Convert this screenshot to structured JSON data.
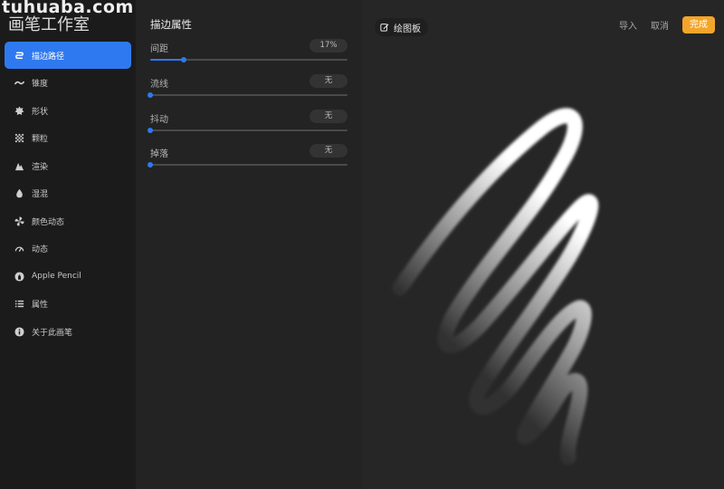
{
  "watermark": "tuhuaba.com",
  "app": {
    "title": "画笔工作室"
  },
  "sidebar": {
    "items": [
      {
        "label": "描边路径",
        "icon": "stroke-path-icon",
        "active": true
      },
      {
        "label": "锥度",
        "icon": "taper-icon"
      },
      {
        "label": "形状",
        "icon": "shape-icon"
      },
      {
        "label": "颗粒",
        "icon": "grain-icon"
      },
      {
        "label": "渲染",
        "icon": "rendering-icon"
      },
      {
        "label": "湿混",
        "icon": "wet-mix-icon"
      },
      {
        "label": "颜色动态",
        "icon": "color-dynamics-icon"
      },
      {
        "label": "动态",
        "icon": "dynamics-icon"
      },
      {
        "label": "Apple Pencil",
        "icon": "apple-pencil-icon"
      },
      {
        "label": "属性",
        "icon": "properties-icon"
      },
      {
        "label": "关于此画笔",
        "icon": "info-icon"
      }
    ]
  },
  "settings": {
    "header": "描边属性",
    "rows": [
      {
        "label": "间距",
        "value": "17%",
        "level": 0.17
      },
      {
        "label": "流线",
        "value": "无",
        "level": 0
      },
      {
        "label": "抖动",
        "value": "无",
        "level": 0
      },
      {
        "label": "掉落",
        "value": "无",
        "level": 0
      }
    ]
  },
  "canvas": {
    "drawing_pad_label": "绘图板",
    "import_label": "导入",
    "cancel_label": "取消",
    "done_label": "完成"
  },
  "colors": {
    "accent": "#2f79f0",
    "done": "#f3a52b",
    "stroke": "#ffffff"
  }
}
